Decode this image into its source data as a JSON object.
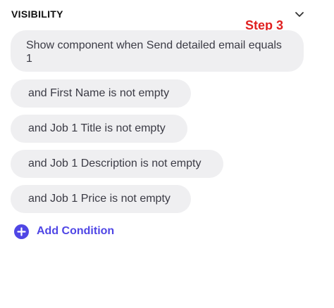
{
  "section": {
    "title": "VISIBILITY",
    "collapse_icon": "chevron-down-icon"
  },
  "annotation": {
    "step_label": "Step 3"
  },
  "conditions": [
    {
      "label": "Show component when Send detailed email equals 1"
    },
    {
      "label": "and First Name is not empty"
    },
    {
      "label": "and Job 1 Title is not empty"
    },
    {
      "label": "and Job 1 Description is not empty"
    },
    {
      "label": "and Job 1 Price is not empty"
    }
  ],
  "add_condition": {
    "label": "Add Condition",
    "icon": "plus-circle-icon"
  },
  "colors": {
    "accent": "#4f46e5",
    "step_label": "#e02020",
    "pill_background": "#efeff1",
    "pill_text": "#3b3b45"
  }
}
